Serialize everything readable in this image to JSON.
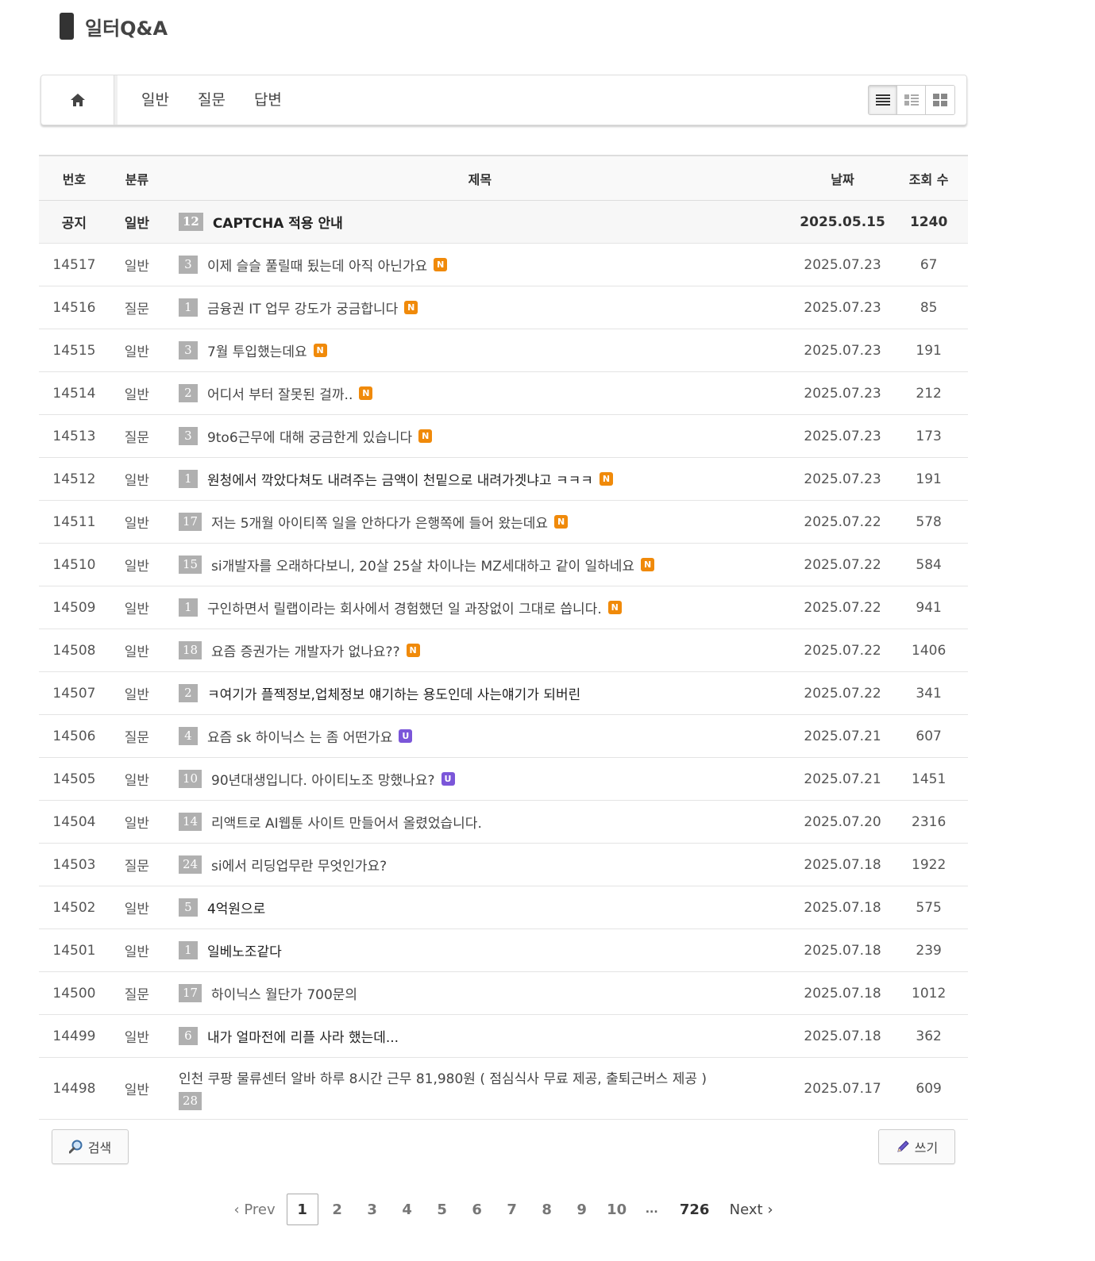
{
  "page_title": "일터Q&A",
  "nav": {
    "tabs": [
      "일반",
      "질문",
      "답변"
    ]
  },
  "table": {
    "headers": {
      "no": "번호",
      "category": "분류",
      "title": "제목",
      "date": "날짜",
      "views": "조회 수"
    },
    "badges": {
      "new": "N",
      "updated": "U"
    },
    "rows": [
      {
        "no": "공지",
        "category": "일반",
        "comments": "12",
        "title": "CAPTCHA 적용 안내",
        "badge": "",
        "date": "2025.05.15",
        "views": "1240"
      },
      {
        "no": "14517",
        "category": "일반",
        "comments": "3",
        "title": "이제 슬슬 풀릴때 됬는데 아직 아닌가요",
        "badge": "new",
        "date": "2025.07.23",
        "views": "67"
      },
      {
        "no": "14516",
        "category": "질문",
        "comments": "1",
        "title": "금융권 IT 업무 강도가 궁금합니다",
        "badge": "new",
        "date": "2025.07.23",
        "views": "85"
      },
      {
        "no": "14515",
        "category": "일반",
        "comments": "3",
        "title": "7월 투입했는데요",
        "badge": "new",
        "date": "2025.07.23",
        "views": "191"
      },
      {
        "no": "14514",
        "category": "일반",
        "comments": "2",
        "title": "어디서 부터 잘못된 걸까..",
        "badge": "new",
        "date": "2025.07.23",
        "views": "212"
      },
      {
        "no": "14513",
        "category": "질문",
        "comments": "3",
        "title": "9to6근무에 대해 궁금한게 있습니다",
        "badge": "new",
        "date": "2025.07.23",
        "views": "173"
      },
      {
        "no": "14512",
        "category": "일반",
        "comments": "1",
        "title": "원청에서 깍았다쳐도 내려주는 금액이 천밑으로 내려가겟냐고 ㅋㅋㅋ",
        "badge": "new",
        "date": "2025.07.23",
        "views": "191"
      },
      {
        "no": "14511",
        "category": "일반",
        "comments": "17",
        "title": "저는 5개월 아이티쪽 일을 안하다가 은행쪽에 들어 왔는데요",
        "badge": "new",
        "date": "2025.07.22",
        "views": "578"
      },
      {
        "no": "14510",
        "category": "일반",
        "comments": "15",
        "title": "si개발자를 오래하다보니, 20살 25살 차이나는 MZ세대하고 같이 일하네요",
        "badge": "new",
        "date": "2025.07.22",
        "views": "584"
      },
      {
        "no": "14509",
        "category": "일반",
        "comments": "1",
        "title": "구인하면서 릴랩이라는 회사에서 경험했던 일 과장없이 그대로 씁니다.",
        "badge": "new",
        "date": "2025.07.22",
        "views": "941"
      },
      {
        "no": "14508",
        "category": "일반",
        "comments": "18",
        "title": "요즘 증권가는 개발자가 없나요??",
        "badge": "new",
        "date": "2025.07.22",
        "views": "1406"
      },
      {
        "no": "14507",
        "category": "일반",
        "comments": "2",
        "title": "ㅋ여기가 플젝정보,업체정보 얘기하는 용도인데 사는얘기가 되버린",
        "badge": "",
        "date": "2025.07.22",
        "views": "341"
      },
      {
        "no": "14506",
        "category": "질문",
        "comments": "4",
        "title": "요즘 sk 하이닉스 는 좀 어떤가요",
        "badge": "up",
        "date": "2025.07.21",
        "views": "607"
      },
      {
        "no": "14505",
        "category": "일반",
        "comments": "10",
        "title": "90년대생입니다. 아이티노조 망했나요?",
        "badge": "up",
        "date": "2025.07.21",
        "views": "1451"
      },
      {
        "no": "14504",
        "category": "일반",
        "comments": "14",
        "title": "리액트로 AI웹툰 사이트 만들어서 올렸었습니다.",
        "badge": "",
        "date": "2025.07.20",
        "views": "2316"
      },
      {
        "no": "14503",
        "category": "질문",
        "comments": "24",
        "title": "si에서 리딩업무란 무엇인가요?",
        "badge": "",
        "date": "2025.07.18",
        "views": "1922"
      },
      {
        "no": "14502",
        "category": "일반",
        "comments": "5",
        "title": "4억원으로",
        "badge": "",
        "date": "2025.07.18",
        "views": "575"
      },
      {
        "no": "14501",
        "category": "일반",
        "comments": "1",
        "title": "일베노조같다",
        "badge": "",
        "date": "2025.07.18",
        "views": "239"
      },
      {
        "no": "14500",
        "category": "질문",
        "comments": "17",
        "title": "하이닉스 월단가 700문의",
        "badge": "",
        "date": "2025.07.18",
        "views": "1012"
      },
      {
        "no": "14499",
        "category": "일반",
        "comments": "6",
        "title": "내가 얼마전에 리플 사라 했는데...",
        "badge": "",
        "date": "2025.07.18",
        "views": "362"
      },
      {
        "no": "14498",
        "category": "일반",
        "comments": "28",
        "title": "인천 쿠팡 물류센터 알바 하루 8시간 근무 81,980원 ( 점심식사 무료 제공, 출퇴근버스 제공 )",
        "badge": "",
        "date": "2025.07.17",
        "views": "609"
      }
    ]
  },
  "buttons": {
    "search": "검색",
    "write": "쓰기"
  },
  "pagination": {
    "prev": "‹ Prev",
    "pages": [
      "1",
      "2",
      "3",
      "4",
      "5",
      "6",
      "7",
      "8",
      "9",
      "10"
    ],
    "current": "1",
    "ellipsis": "...",
    "last": "726",
    "next": "Next ›"
  },
  "colors": {
    "new_badge": "#f08a0a",
    "updated_badge": "#7b56d9",
    "comment_count_bg": "#b0b0b0"
  }
}
